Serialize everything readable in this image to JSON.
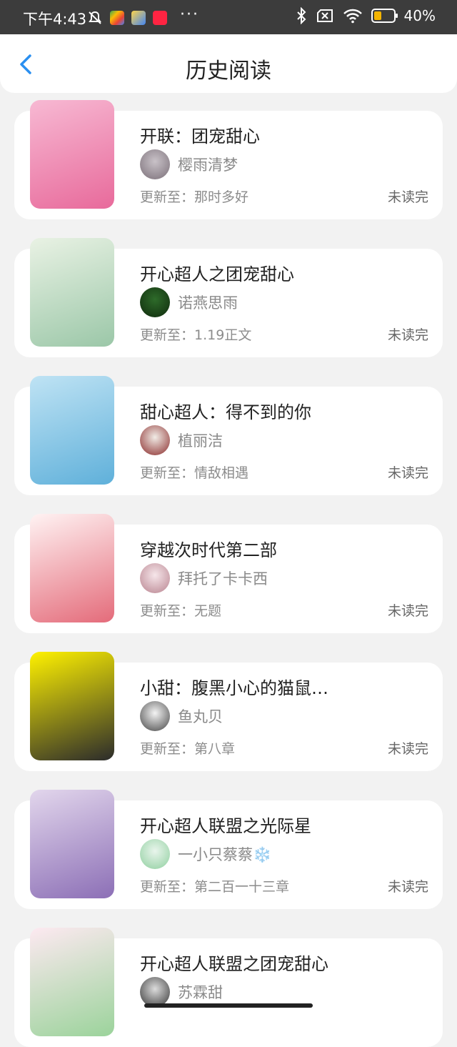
{
  "status_bar": {
    "time": "下午4:43",
    "battery_percent": "40%",
    "battery_level": 0.4,
    "more": "···",
    "icons": [
      "mute-icon",
      "play-store-icon",
      "app-icon",
      "xiaohongshu-icon",
      "bluetooth-icon",
      "no-sim-icon",
      "wifi-icon",
      "battery-icon"
    ]
  },
  "header": {
    "title": "历史阅读",
    "back_icon": "chevron-left-icon"
  },
  "colors": {
    "accent": "#2a8ff0",
    "background": "#f2f2f2",
    "card": "#ffffff"
  },
  "update_prefix": "更新至：",
  "books": [
    {
      "title": "开联：团宠甜心",
      "author": "樱雨清梦",
      "update": "那时多好",
      "status": "未读完",
      "cover_colors": [
        "#f7b9d3",
        "#e86a9b"
      ],
      "avatar_colors": [
        "#c9c2c8",
        "#7a6f78"
      ]
    },
    {
      "title": "开心超人之团宠甜心",
      "author": "诺燕思雨",
      "update": "1.19正文",
      "status": "未读完",
      "cover_colors": [
        "#e9f2e4",
        "#9bc7a8"
      ],
      "avatar_colors": [
        "#2e6b2a",
        "#0f2a0d"
      ]
    },
    {
      "title": "甜心超人：得不到的你",
      "author": "植丽洁",
      "update": "情敌相遇",
      "status": "未读完",
      "cover_colors": [
        "#bfe3f4",
        "#5fb0da"
      ],
      "avatar_colors": [
        "#f1ece6",
        "#8a2a2a"
      ]
    },
    {
      "title": "穿越次时代第二部",
      "author": "拜托了卡卡西",
      "update": "无题",
      "status": "未读完",
      "cover_colors": [
        "#fff3f3",
        "#e46b7a"
      ],
      "avatar_colors": [
        "#f6e6ea",
        "#b8838f"
      ]
    },
    {
      "title": "小甜：腹黑小心的猫鼠…",
      "author": "鱼丸贝",
      "update": "第八章",
      "status": "未读完",
      "cover_colors": [
        "#fff200",
        "#2b2b2b"
      ],
      "avatar_colors": [
        "#f4f4f4",
        "#444444"
      ]
    },
    {
      "title": "开心超人联盟之光际星",
      "author": "一小只蔡蔡❄️",
      "update": "第二百一十三章",
      "status": "未读完",
      "cover_colors": [
        "#e2d6ec",
        "#8c6fb6"
      ],
      "avatar_colors": [
        "#e9f5ec",
        "#8fcf9f"
      ]
    },
    {
      "title": "开心超人联盟之团宠甜心",
      "author": "苏霖甜",
      "update": "",
      "status": "",
      "cover_colors": [
        "#fde9f1",
        "#9bd39b"
      ],
      "avatar_colors": [
        "#dcdcdc",
        "#333333"
      ]
    }
  ]
}
